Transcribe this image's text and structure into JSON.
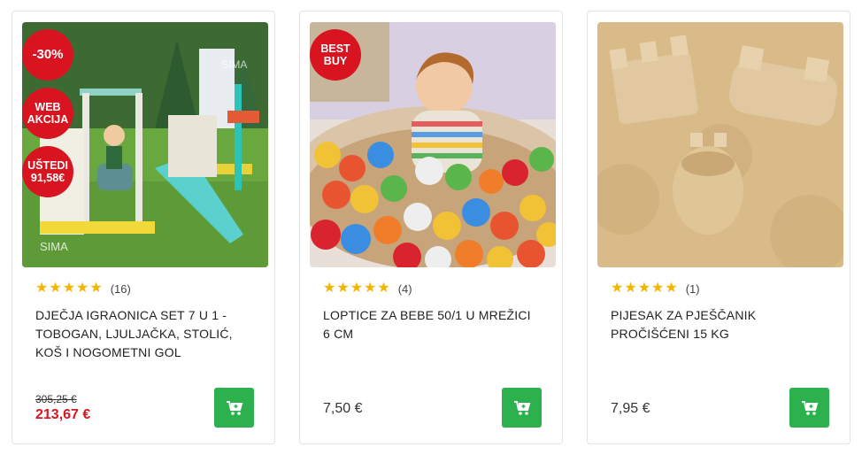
{
  "products": [
    {
      "badges": [
        "-30%",
        "WEB AKCIJA",
        "UŠTEDI 91,58€"
      ],
      "image_icon": "playground-set-image",
      "stars": 5,
      "review_count": "(16)",
      "title": "DJEČJA IGRAONICA SET 7 u 1 - TOBOGAN, LJULJAČKA, STOLIĆ, KOŠ i NOGOMETNI GOL",
      "old_price": "305,25 €",
      "price": "213,67 €"
    },
    {
      "badges": [
        "BEST BUY"
      ],
      "image_icon": "ball-pit-image",
      "stars": 5,
      "review_count": "(4)",
      "title": "LOPTICE ZA BEBE 50/1 U MREŽICI 6 CM",
      "price": "7,50 €"
    },
    {
      "badges": [],
      "image_icon": "sand-castle-image",
      "stars": 5,
      "review_count": "(1)",
      "title": "PIJESAK ZA PJEŠČANIK PROČIŠĆENI 15 KG",
      "price": "7,95 €"
    }
  ],
  "ui": {
    "star_glyph": "★",
    "cart_icon": "cart-plus-icon",
    "accent_green": "#2db14f",
    "badge_red": "#d7141f",
    "star_color": "#f5b400",
    "image_watermark": "SIMA"
  }
}
